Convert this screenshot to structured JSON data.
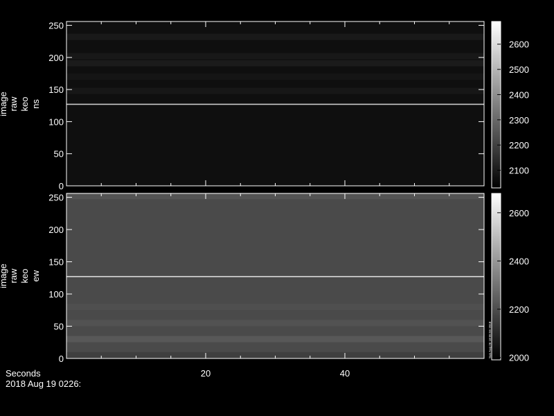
{
  "chart_data": [
    {
      "type": "heatmap",
      "title": "",
      "ylabel_lines": [
        "image",
        "raw",
        "keo",
        "ns"
      ],
      "xlim": [
        0,
        60
      ],
      "ylim": [
        0,
        256
      ],
      "yticks": [
        0,
        50,
        100,
        150,
        200,
        250
      ],
      "colorbar": {
        "ticks": [
          2100,
          2200,
          2300,
          2400,
          2500,
          2600
        ],
        "range": [
          2030,
          2690
        ]
      },
      "background_level": 2070,
      "bands": [
        {
          "y": 127,
          "level": 2560,
          "sharp": true
        },
        {
          "y": 148,
          "level": 2110
        },
        {
          "y": 170,
          "level": 2100
        },
        {
          "y": 191,
          "level": 2130
        },
        {
          "y": 202,
          "level": 2115
        },
        {
          "y": 232,
          "level": 2120
        }
      ]
    },
    {
      "type": "heatmap",
      "title": "",
      "ylabel_lines": [
        "image",
        "raw",
        "keo",
        "ew"
      ],
      "xlim": [
        0,
        60
      ],
      "ylim": [
        0,
        256
      ],
      "yticks": [
        0,
        50,
        100,
        150,
        200,
        250
      ],
      "xticks": [
        20,
        40
      ],
      "colorbar": {
        "ticks": [
          2000,
          2200,
          2400,
          2600
        ],
        "range": [
          1990,
          2680
        ],
        "label": "Sun Aug 26 18:05:55 2018"
      },
      "background_level": 2190,
      "bands": [
        {
          "y": 127,
          "level": 2580,
          "sharp": true
        },
        {
          "y": 5,
          "level": 2140
        },
        {
          "y": 30,
          "level": 2260
        },
        {
          "y": 55,
          "level": 2230
        },
        {
          "y": 80,
          "level": 2215
        },
        {
          "y": 252,
          "level": 2240
        }
      ]
    }
  ],
  "footer": {
    "xlabel": "Seconds",
    "date": "2018 Aug 19 0226:"
  }
}
